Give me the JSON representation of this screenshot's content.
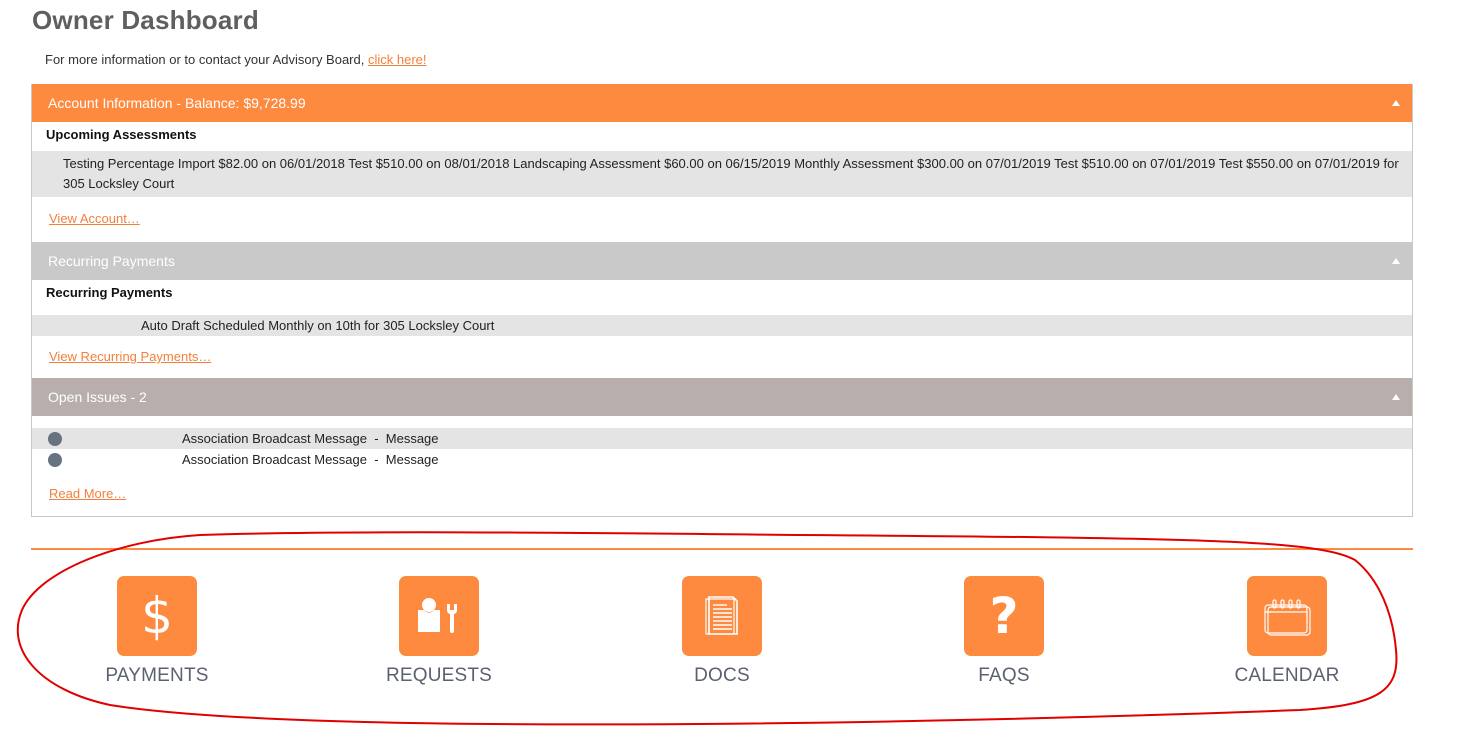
{
  "page": {
    "title": "Owner Dashboard",
    "intro_text": "For more information or to contact your Advisory Board, ",
    "intro_link": "click here!"
  },
  "account_panel": {
    "header": "Account Information - Balance: $9,728.99",
    "section_title": "Upcoming Assessments",
    "assessments_text": "Testing Percentage Import $82.00 on 06/01/2018 Test $510.00 on 08/01/2018 Landscaping Assessment $60.00 on 06/15/2019 Monthly Assessment $300.00 on 07/01/2019 Test $510.00 on 07/01/2019 Test $550.00 on 07/01/2019 for 305 Locksley Court",
    "link": "View Account…"
  },
  "recurring_panel": {
    "header": "Recurring Payments",
    "section_title": "Recurring Payments",
    "row_text": "Auto Draft Scheduled Monthly on 10th for 305 Locksley Court",
    "link": "View Recurring Payments…"
  },
  "issues_panel": {
    "header": "Open Issues - 2",
    "issues": [
      {
        "text": "Association Broadcast Message  -  Message",
        "status_icon": "dot-icon"
      },
      {
        "text": "Association Broadcast Message  -  Message",
        "status_icon": "dot-icon"
      }
    ],
    "link": "Read More…"
  },
  "tiles": [
    {
      "label": "PAYMENTS",
      "icon": "dollar-icon",
      "glyph": "$"
    },
    {
      "label": "REQUESTS",
      "icon": "maintenance-request-icon"
    },
    {
      "label": "DOCS",
      "icon": "document-icon"
    },
    {
      "label": "FAQS",
      "icon": "question-icon",
      "glyph": "?"
    },
    {
      "label": "CALENDAR",
      "icon": "calendar-icon"
    }
  ],
  "colors": {
    "accent": "#fe8a40",
    "link": "#f47f3b",
    "gray_header": "#c9c9c9",
    "taupe_header": "#b8afac",
    "annotation": "#e00000"
  }
}
